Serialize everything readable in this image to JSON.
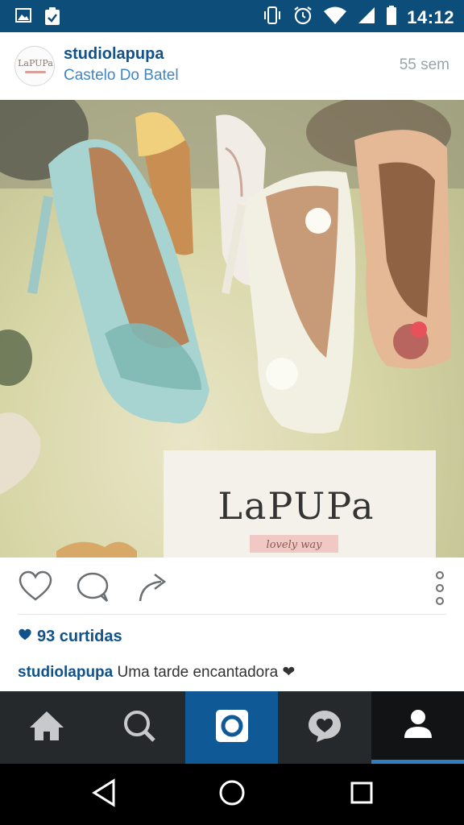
{
  "status_bar": {
    "time": "14:12",
    "icons_left": [
      "image-icon",
      "clipboard-check-icon"
    ],
    "icons_right": [
      "vibrate-icon",
      "alarm-icon",
      "wifi-icon",
      "signal-icon",
      "battery-icon"
    ]
  },
  "post": {
    "username": "studiolapupa",
    "location": "Castelo Do Batel",
    "time_ago": "55 sem",
    "avatar_text": "LaPUPa",
    "photo_sign_text": "LaPUPa",
    "photo_sign_sub": "lovely way",
    "likes": "93 curtidas",
    "caption_user": "studiolapupa",
    "caption_text": "Uma tarde encantadora ❤"
  },
  "colors": {
    "status_bar": "#0d4d7a",
    "link_blue": "#11528a",
    "location_blue": "#3f86c7",
    "nav_bg": "#26292b",
    "nav_active": "#0f5a96"
  },
  "bottom_nav": [
    "home",
    "search",
    "camera",
    "activity",
    "profile"
  ]
}
